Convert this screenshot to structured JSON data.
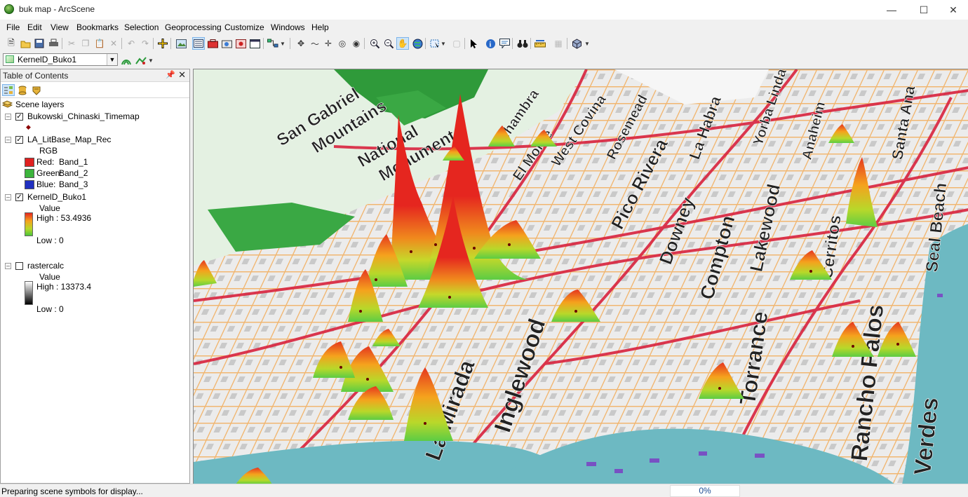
{
  "window": {
    "title": "buk map - ArcScene",
    "minimize": "—",
    "maximize": "☐",
    "close": "✕"
  },
  "menu": [
    "File",
    "Edit",
    "View",
    "Bookmarks",
    "Selection",
    "Geoprocessing",
    "Customize",
    "Windows",
    "Help"
  ],
  "layer_selector": {
    "value": "KernelD_Buko1",
    "icon": "raster-layer-icon"
  },
  "toc": {
    "title": "Table of Contents",
    "root": "Scene layers",
    "layers": [
      {
        "name": "Bukowski_Chinaski_Timemap",
        "checked": true,
        "symbol": "◆",
        "symbol_color": "#8b0000"
      },
      {
        "name": "LA_LitBase_Map_Rec",
        "checked": true,
        "legend_title": "RGB",
        "bands": [
          {
            "label": "Red:",
            "band": "Band_1",
            "color": "#e02020"
          },
          {
            "label": "Green:",
            "band": "Band_2",
            "color": "#3cb43c"
          },
          {
            "label": "Blue:",
            "band": "Band_3",
            "color": "#2030c0"
          }
        ]
      },
      {
        "name": "KernelD_Buko1",
        "checked": true,
        "legend_title": "Value",
        "high": "High : 53.4936",
        "low": "Low : 0",
        "ramp": [
          "#e5261f",
          "#f5a21d",
          "#b8d82a",
          "#4cc43a"
        ]
      },
      {
        "name": "rastercalc",
        "checked": false,
        "legend_title": "Value",
        "high": "High : 13373.4",
        "low": "Low : 0",
        "ramp": [
          "#ffffff",
          "#000000"
        ]
      }
    ]
  },
  "map_labels": [
    "San Gabriel",
    "Mountains",
    "National",
    "Monument",
    "Alhambra",
    "El Monte",
    "West Covina",
    "Rosemead",
    "La Habra",
    "Yorba Linda",
    "Anaheim",
    "Santa Ana",
    "Pico Rivera",
    "Downey",
    "Compton",
    "Lakewood",
    "Cerritos",
    "Seal Beach",
    "Inglewood",
    "Torrance",
    "La Mirada",
    "Rancho Palos",
    "Verdes"
  ],
  "status": {
    "message": "Preparing scene symbols for display...",
    "progress": "0%"
  }
}
